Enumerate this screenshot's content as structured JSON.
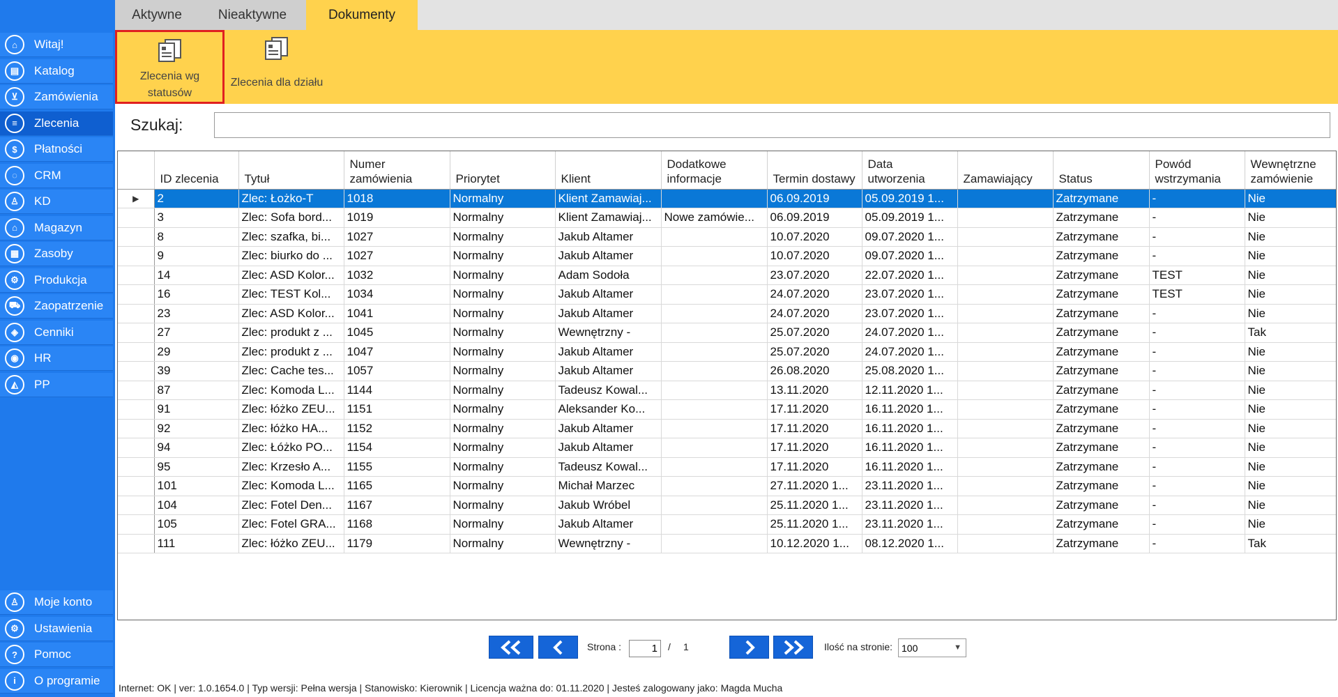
{
  "sidebar": {
    "items": [
      {
        "label": "Witaj!",
        "icon": "home-icon",
        "glyph": "⌂"
      },
      {
        "label": "Katalog",
        "icon": "book-icon",
        "glyph": "▤"
      },
      {
        "label": "Zamówienia",
        "icon": "cart-icon",
        "glyph": "⊻"
      },
      {
        "label": "Zlecenia",
        "icon": "list-icon",
        "glyph": "≡"
      },
      {
        "label": "Płatności",
        "icon": "dollar-icon",
        "glyph": "$"
      },
      {
        "label": "CRM",
        "icon": "crm-icon",
        "glyph": "◌"
      },
      {
        "label": "KD",
        "icon": "person-icon",
        "glyph": "♙"
      },
      {
        "label": "Magazyn",
        "icon": "warehouse-icon",
        "glyph": "⌂"
      },
      {
        "label": "Zasoby",
        "icon": "resources-icon",
        "glyph": "▦"
      },
      {
        "label": "Produkcja",
        "icon": "production-icon",
        "glyph": "⚙"
      },
      {
        "label": "Zaopatrzenie",
        "icon": "truck-icon",
        "glyph": "⛟"
      },
      {
        "label": "Cenniki",
        "icon": "tag-icon",
        "glyph": "◈"
      },
      {
        "label": "HR",
        "icon": "hr-icon",
        "glyph": "◉"
      },
      {
        "label": "PP",
        "icon": "pp-icon",
        "glyph": "◭"
      }
    ],
    "bottom": [
      {
        "label": "Moje konto",
        "icon": "user-icon",
        "glyph": "♙"
      },
      {
        "label": "Ustawienia",
        "icon": "gear-icon",
        "glyph": "⚙"
      },
      {
        "label": "Pomoc",
        "icon": "help-icon",
        "glyph": "?"
      },
      {
        "label": "O programie",
        "icon": "info-icon",
        "glyph": "i"
      }
    ],
    "active_index": 3
  },
  "tabs": [
    "Aktywne",
    "Nieaktywne",
    "Dokumenty"
  ],
  "ribbon": {
    "btn1_label": "Zlecenia wg statusów",
    "btn2_label": "Zlecenia dla działu"
  },
  "search": {
    "label": "Szukaj:",
    "value": ""
  },
  "table": {
    "columns": [
      "ID zlecenia",
      "Tytuł",
      "Numer zamówienia",
      "Priorytet",
      "Klient",
      "Dodatkowe informacje",
      "Termin dostawy",
      "Data utworzenia",
      "Zamawiający",
      "Status",
      "Powód wstrzymania",
      "Wewnętrzne zamówienie"
    ],
    "rows": [
      [
        "2",
        "Zlec: Łożko-T",
        "1018",
        "Normalny",
        "Klient Zamawiaj...",
        "",
        "06.09.2019",
        "05.09.2019 1...",
        "",
        "Zatrzymane",
        "-",
        "Nie"
      ],
      [
        "3",
        "Zlec: Sofa bord...",
        "1019",
        "Normalny",
        "Klient Zamawiaj...",
        "Nowe zamówie...",
        "06.09.2019",
        "05.09.2019 1...",
        "",
        "Zatrzymane",
        "-",
        "Nie"
      ],
      [
        "8",
        "Zlec: szafka, bi...",
        "1027",
        "Normalny",
        "Jakub  Altamer",
        "",
        "10.07.2020",
        "09.07.2020 1...",
        "",
        "Zatrzymane",
        "-",
        "Nie"
      ],
      [
        "9",
        "Zlec: biurko do ...",
        "1027",
        "Normalny",
        "Jakub  Altamer",
        "",
        "10.07.2020",
        "09.07.2020 1...",
        "",
        "Zatrzymane",
        "-",
        "Nie"
      ],
      [
        "14",
        "Zlec: ASD Kolor...",
        "1032",
        "Normalny",
        "Adam Sodoła",
        "",
        "23.07.2020",
        "22.07.2020 1...",
        "",
        "Zatrzymane",
        "TEST",
        "Nie"
      ],
      [
        "16",
        "Zlec: TEST Kol...",
        "1034",
        "Normalny",
        "Jakub  Altamer",
        "",
        "24.07.2020",
        "23.07.2020 1...",
        "",
        "Zatrzymane",
        "TEST",
        "Nie"
      ],
      [
        "23",
        "Zlec: ASD Kolor...",
        "1041",
        "Normalny",
        "Jakub  Altamer",
        "",
        "24.07.2020",
        "23.07.2020 1...",
        "",
        "Zatrzymane",
        "-",
        "Nie"
      ],
      [
        "27",
        "Zlec: produkt z ...",
        "1045",
        "Normalny",
        "Wewnętrzny -",
        "",
        "25.07.2020",
        "24.07.2020 1...",
        "",
        "Zatrzymane",
        "-",
        "Tak"
      ],
      [
        "29",
        "Zlec: produkt z ...",
        "1047",
        "Normalny",
        "Jakub  Altamer",
        "",
        "25.07.2020",
        "24.07.2020 1...",
        "",
        "Zatrzymane",
        "-",
        "Nie"
      ],
      [
        "39",
        "Zlec: Cache tes...",
        "1057",
        "Normalny",
        "Jakub  Altamer",
        "",
        "26.08.2020",
        "25.08.2020 1...",
        "",
        "Zatrzymane",
        "-",
        "Nie"
      ],
      [
        "87",
        "Zlec: Komoda L...",
        "1144",
        "Normalny",
        "Tadeusz Kowal...",
        "",
        "13.11.2020",
        "12.11.2020 1...",
        "",
        "Zatrzymane",
        "-",
        "Nie"
      ],
      [
        "91",
        "Zlec: łóżko ZEU...",
        "1151",
        "Normalny",
        "Aleksander Ko...",
        "",
        "17.11.2020",
        "16.11.2020 1...",
        "",
        "Zatrzymane",
        "-",
        "Nie"
      ],
      [
        "92",
        "Zlec: łóżko HA...",
        "1152",
        "Normalny",
        "Jakub  Altamer",
        "",
        "17.11.2020",
        "16.11.2020 1...",
        "",
        "Zatrzymane",
        "-",
        "Nie"
      ],
      [
        "94",
        "Zlec: Łóżko PO...",
        "1154",
        "Normalny",
        "Jakub  Altamer",
        "",
        "17.11.2020",
        "16.11.2020 1...",
        "",
        "Zatrzymane",
        "-",
        "Nie"
      ],
      [
        "95",
        "Zlec: Krzesło A...",
        "1155",
        "Normalny",
        "Tadeusz Kowal...",
        "",
        "17.11.2020",
        "16.11.2020 1...",
        "",
        "Zatrzymane",
        "-",
        "Nie"
      ],
      [
        "101",
        "Zlec: Komoda L...",
        "1165",
        "Normalny",
        "Michał Marzec",
        "",
        "27.11.2020 1...",
        "23.11.2020 1...",
        "",
        "Zatrzymane",
        "-",
        "Nie"
      ],
      [
        "104",
        "Zlec: Fotel Den...",
        "1167",
        "Normalny",
        "Jakub Wróbel",
        "",
        "25.11.2020 1...",
        "23.11.2020 1...",
        "",
        "Zatrzymane",
        "-",
        "Nie"
      ],
      [
        "105",
        "Zlec: Fotel GRA...",
        "1168",
        "Normalny",
        "Jakub  Altamer",
        "",
        "25.11.2020 1...",
        "23.11.2020 1...",
        "",
        "Zatrzymane",
        "-",
        "Nie"
      ],
      [
        "111",
        "Zlec: łóżko ZEU...",
        "1179",
        "Normalny",
        "Wewnętrzny -",
        "",
        "10.12.2020 1...",
        "08.12.2020 1...",
        "",
        "Zatrzymane",
        "-",
        "Tak"
      ]
    ],
    "selected_row": 0
  },
  "pager": {
    "page_label": "Strona :",
    "current_page": "1",
    "separator": "/",
    "total_pages": "1",
    "per_page_label": "Ilość na stronie:",
    "per_page_value": "100"
  },
  "statusbar": {
    "text": "Internet: OK  |   ver: 1.0.1654.0   |   Typ wersji: Pełna wersja   |   Stanowisko: Kierownik   |   Licencja ważna do: 01.11.2020   |   Jesteś zalogowany jako: Magda Mucha"
  },
  "colors": {
    "sidebar": "#1f7aec",
    "ribbon": "#ffd24d",
    "selection": "#0a78d7",
    "pager_button": "#1565d8"
  }
}
